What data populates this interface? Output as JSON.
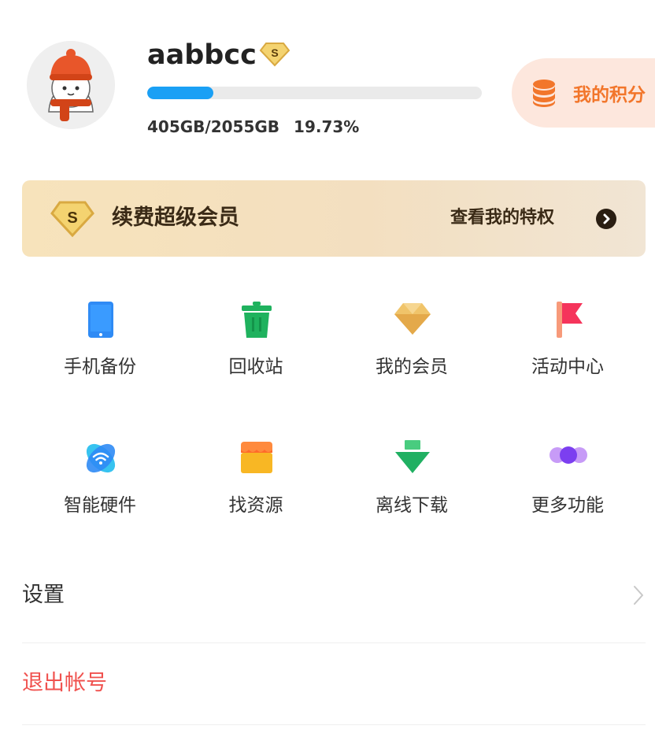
{
  "profile": {
    "username": "aabbcc",
    "vip_badge_letter": "S",
    "storage_used": "405GB/2055GB",
    "storage_percent": "19.73%",
    "storage_fraction": 0.1973
  },
  "points": {
    "label": "我的积分",
    "icon": "coin-stack-icon"
  },
  "vip_banner": {
    "badge_letter": "S",
    "title": "续费超级会员",
    "link_label": "查看我的特权"
  },
  "features": [
    {
      "label": "手机备份",
      "icon": "phone-icon",
      "color": "#2f8bf5"
    },
    {
      "label": "回收站",
      "icon": "trash-icon",
      "color": "#1fb25e"
    },
    {
      "label": "我的会员",
      "icon": "diamond-icon",
      "color": "#e9b85a"
    },
    {
      "label": "活动中心",
      "icon": "flag-icon",
      "color": "#f5345b"
    },
    {
      "label": "智能硬件",
      "icon": "wifi-icon",
      "color": "#2f9bf5"
    },
    {
      "label": "找资源",
      "icon": "store-icon",
      "color": "#f8b724"
    },
    {
      "label": "离线下载",
      "icon": "download-icon",
      "color": "#20b062"
    },
    {
      "label": "更多功能",
      "icon": "more-icon",
      "color": "#9a63f0"
    }
  ],
  "menu": {
    "settings_label": "设置",
    "logout_label": "退出帐号"
  },
  "colors": {
    "accent_blue": "#1aa0f5",
    "points_orange": "#f2762b",
    "logout_red": "#f0524f",
    "vip_gold": "#e7b24a"
  }
}
